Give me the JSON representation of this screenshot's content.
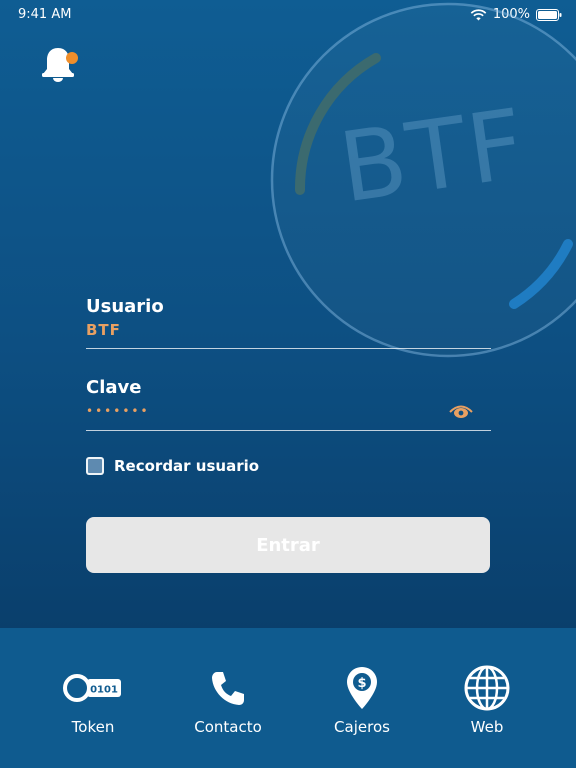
{
  "status": {
    "time": "9:41 AM",
    "battery": "100%"
  },
  "watermark": {
    "text": "BTF"
  },
  "form": {
    "usuario": {
      "label": "Usuario",
      "value": "BTF"
    },
    "clave": {
      "label": "Clave",
      "value": "•••••••"
    },
    "remember_label": "Recordar usuario",
    "remember_checked": false,
    "submit_label": "Entrar"
  },
  "nav": [
    {
      "label": "Token",
      "icon": "token-icon",
      "icon_text": "0101"
    },
    {
      "label": "Contacto",
      "icon": "phone-icon"
    },
    {
      "label": "Cajeros",
      "icon": "location-pin-dollar-icon",
      "icon_text": "$"
    },
    {
      "label": "Web",
      "icon": "globe-icon"
    }
  ],
  "colors": {
    "accent": "#ef8e2b",
    "field_value": "#e8a062",
    "background": "#0d4f82",
    "button": "#e7e7e7"
  }
}
